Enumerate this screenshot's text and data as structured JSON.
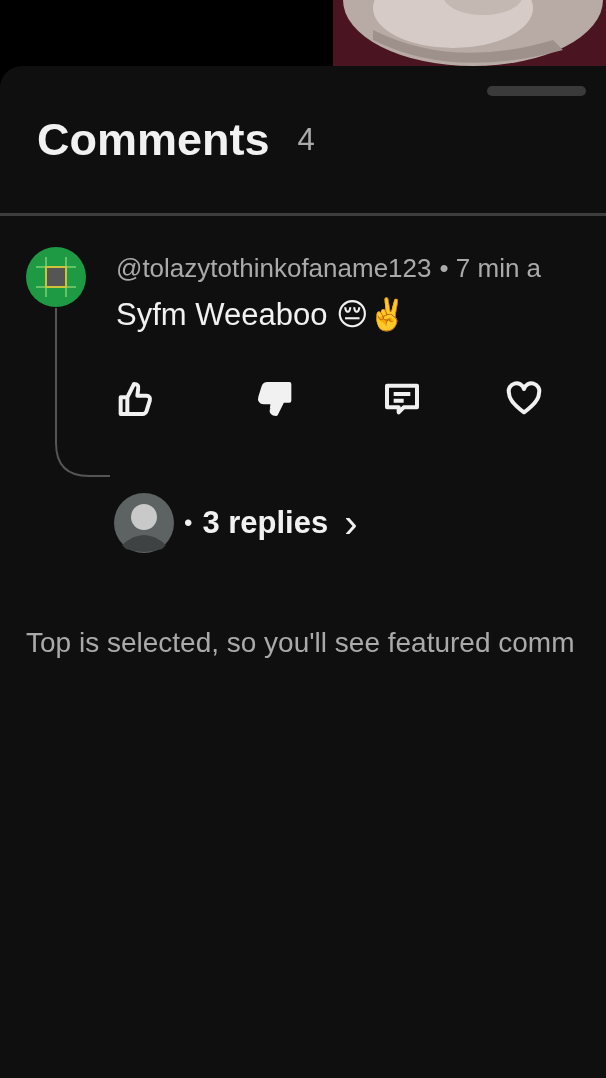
{
  "header": {
    "title": "Comments",
    "count": "4"
  },
  "comment": {
    "handle": "@tolazytothinkofaname123",
    "time": "• 7 min a",
    "body": "Syfm Weeaboo 😔✌️",
    "actions": [
      {
        "kind": "like",
        "selected": false
      },
      {
        "kind": "dislike",
        "selected": true
      },
      {
        "kind": "reply"
      },
      {
        "kind": "heart",
        "selected": false
      }
    ],
    "replies": {
      "dot": "•",
      "label": "3 replies",
      "arrow": "›"
    }
  },
  "footer": "Top is selected, so you'll see featured comm"
}
